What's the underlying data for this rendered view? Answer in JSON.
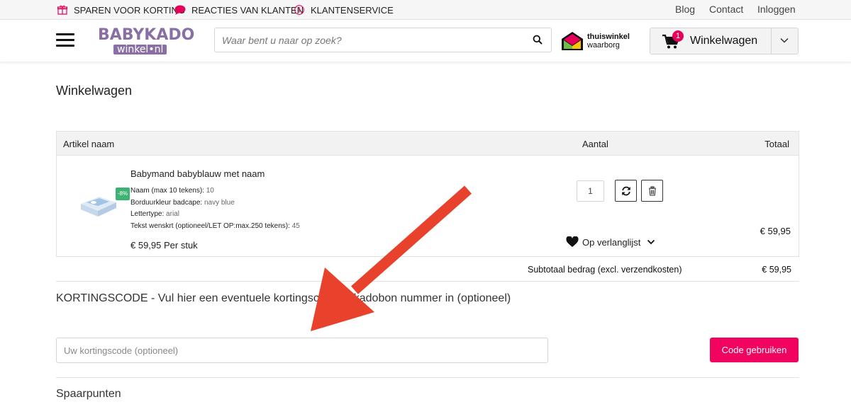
{
  "topbar": {
    "usps": [
      {
        "label": "SPAREN VOOR KORTING",
        "icon": "gift-icon"
      },
      {
        "label": "REACTIES VAN KLANTEN",
        "icon": "chat-bubble-icon"
      },
      {
        "label": "KLANTENSERVICE",
        "icon": "info-icon"
      }
    ],
    "links": [
      "Blog",
      "Contact",
      "Inloggen"
    ]
  },
  "header": {
    "logo_line1": "BABYKADO",
    "logo_line2": "winkel•nl",
    "search_placeholder": "Waar bent u naar op zoek?",
    "trust_line1": "thuiswinkel",
    "trust_line2": "waarborg",
    "cart_label": "Winkelwagen",
    "cart_count": "1"
  },
  "page": {
    "title": "Winkelwagen"
  },
  "cart_table": {
    "headers": {
      "name": "Artikel naam",
      "qty": "Aantal",
      "total": "Totaal"
    },
    "item": {
      "name": "Babymand babyblauw met naam",
      "discount": "-8%",
      "attributes": [
        {
          "label": "Naam (max 10 tekens):",
          "value": "10"
        },
        {
          "label": "Borduurkleur badcape:",
          "value": "navy blue"
        },
        {
          "label": "Lettertype:",
          "value": "arial"
        },
        {
          "label": "Tekst wenskrt (optioneel/LET OP:max.250 tekens):",
          "value": "45"
        }
      ],
      "unit_price": "€ 59,95 Per stuk",
      "quantity": "1",
      "wishlist_label": "Op verlanglijst",
      "total": "€ 59,95"
    },
    "subtotal_label": "Subtotaal bedrag (excl. verzendkosten)",
    "subtotal_value": "€ 59,95"
  },
  "coupon": {
    "heading": "KORTINGSCODE - Vul hier een eventuele kortingscode of kadobon nummer in (optioneel)",
    "placeholder": "Uw kortingscode (optioneel)",
    "button_label": "Code gebruiken"
  },
  "loyalty": {
    "heading": "Spaarpunten"
  },
  "colors": {
    "accent": "#f0045f",
    "badge": "#e5005a",
    "brand": "#8a6fa6",
    "discount": "#3cb371",
    "arrow": "#e8412c"
  }
}
